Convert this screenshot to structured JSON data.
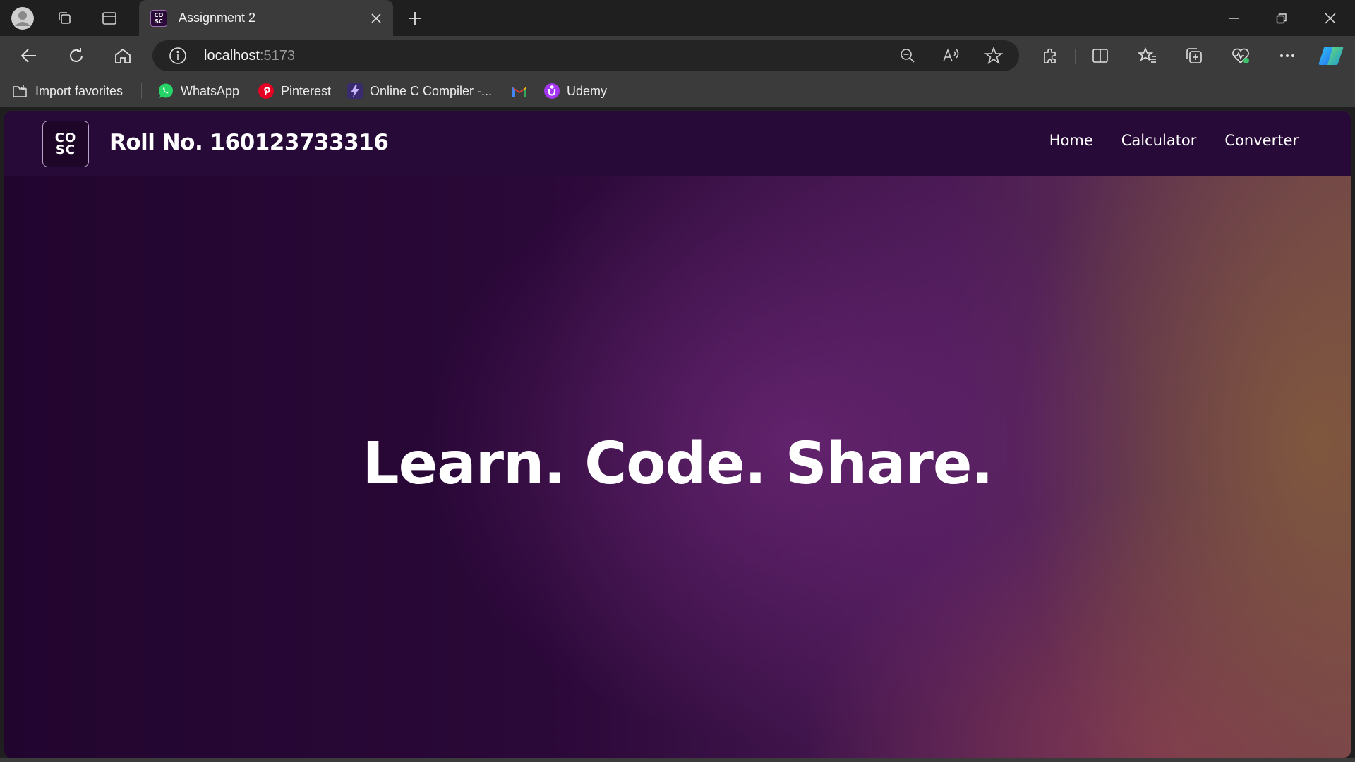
{
  "browser": {
    "tab": {
      "title": "Assignment 2",
      "favicon_text": "CO\nSC"
    },
    "address": {
      "host": "localhost",
      "port": ":5173"
    },
    "favorites": [
      {
        "label": "Import favorites",
        "icon": "import-favorites-icon"
      },
      {
        "label": "WhatsApp",
        "icon": "whatsapp-icon",
        "color": "#25d366"
      },
      {
        "label": "Pinterest",
        "icon": "pinterest-icon",
        "color": "#e60023"
      },
      {
        "label": "Online C Compiler -...",
        "icon": "compiler-icon",
        "color": "#6c3dc5"
      },
      {
        "label": "",
        "icon": "gmail-icon"
      },
      {
        "label": "Udemy",
        "icon": "udemy-icon",
        "color": "#a435f0"
      }
    ]
  },
  "page": {
    "logo_text": "CO\nSC",
    "brand": "Roll No. 160123733316",
    "nav": {
      "home": "Home",
      "calculator": "Calculator",
      "converter": "Converter"
    },
    "hero": "Learn. Code. Share."
  },
  "colors": {
    "navbar": "#270a37",
    "background_dark": "#22052f",
    "background_purple": "#5a1f62",
    "background_warm": "#7a5548"
  }
}
